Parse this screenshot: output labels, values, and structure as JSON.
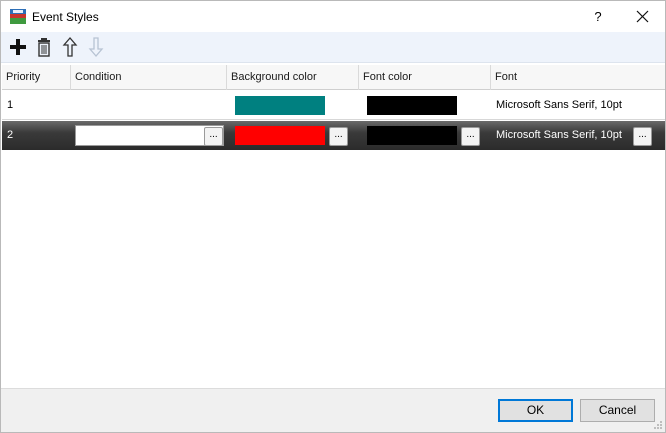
{
  "window": {
    "title": "Event Styles",
    "help_label": "?"
  },
  "toolbar": {
    "add_icon": "plus-icon",
    "delete_icon": "trash-icon",
    "up_icon": "arrow-up-icon",
    "down_icon": "arrow-down-icon"
  },
  "grid": {
    "columns": [
      "Priority",
      "Condition",
      "Background color",
      "Font color",
      "Font"
    ],
    "rows": [
      {
        "priority": "1",
        "condition": "",
        "background_color": "#008080",
        "font_color": "#000000",
        "font": "Microsoft Sans Serif, 10pt"
      },
      {
        "priority": "2",
        "condition": "",
        "background_color": "#ff0000",
        "font_color": "#000000",
        "font": "Microsoft Sans Serif, 10pt"
      }
    ],
    "ellipsis_label": "..."
  },
  "footer": {
    "ok_label": "OK",
    "cancel_label": "Cancel"
  }
}
